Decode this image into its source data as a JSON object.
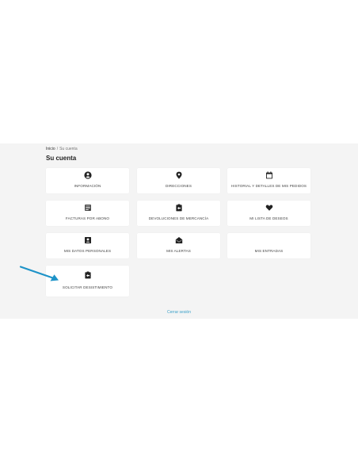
{
  "breadcrumb": {
    "home": "Inicio",
    "separator": "/",
    "current": "Su cuenta"
  },
  "page_title": "Su cuenta",
  "cards": [
    {
      "label": "INFORMACIÓN",
      "icon": "user-circle-icon"
    },
    {
      "label": "DIRECCIONES",
      "icon": "map-pin-icon"
    },
    {
      "label": "HISTORIAL Y DETALLES DE MIS PEDIDOS",
      "icon": "calendar-icon"
    },
    {
      "label": "FACTURAS POR ABONO",
      "icon": "document-list-icon"
    },
    {
      "label": "DEVOLUCIONES DE MERCANCÍA",
      "icon": "clipboard-return-icon"
    },
    {
      "label": "MI LISTA DE DESEOS",
      "icon": "heart-icon"
    },
    {
      "label": "MIS DATOS PERSONALES",
      "icon": "id-card-icon"
    },
    {
      "label": "MIS ALERTAS",
      "icon": "open-envelope-icon"
    },
    {
      "label": "MIS ENTRADAS",
      "icon": ""
    },
    {
      "label": "SOLICITAR DESISTIMIENTO",
      "icon": "clipboard-return-icon"
    }
  ],
  "logout": "Cerrar sesión",
  "colors": {
    "band_background": "#f4f4f4",
    "card_background": "#ffffff",
    "link": "#3aa0c8",
    "annotation_arrow": "#1e93c8"
  }
}
